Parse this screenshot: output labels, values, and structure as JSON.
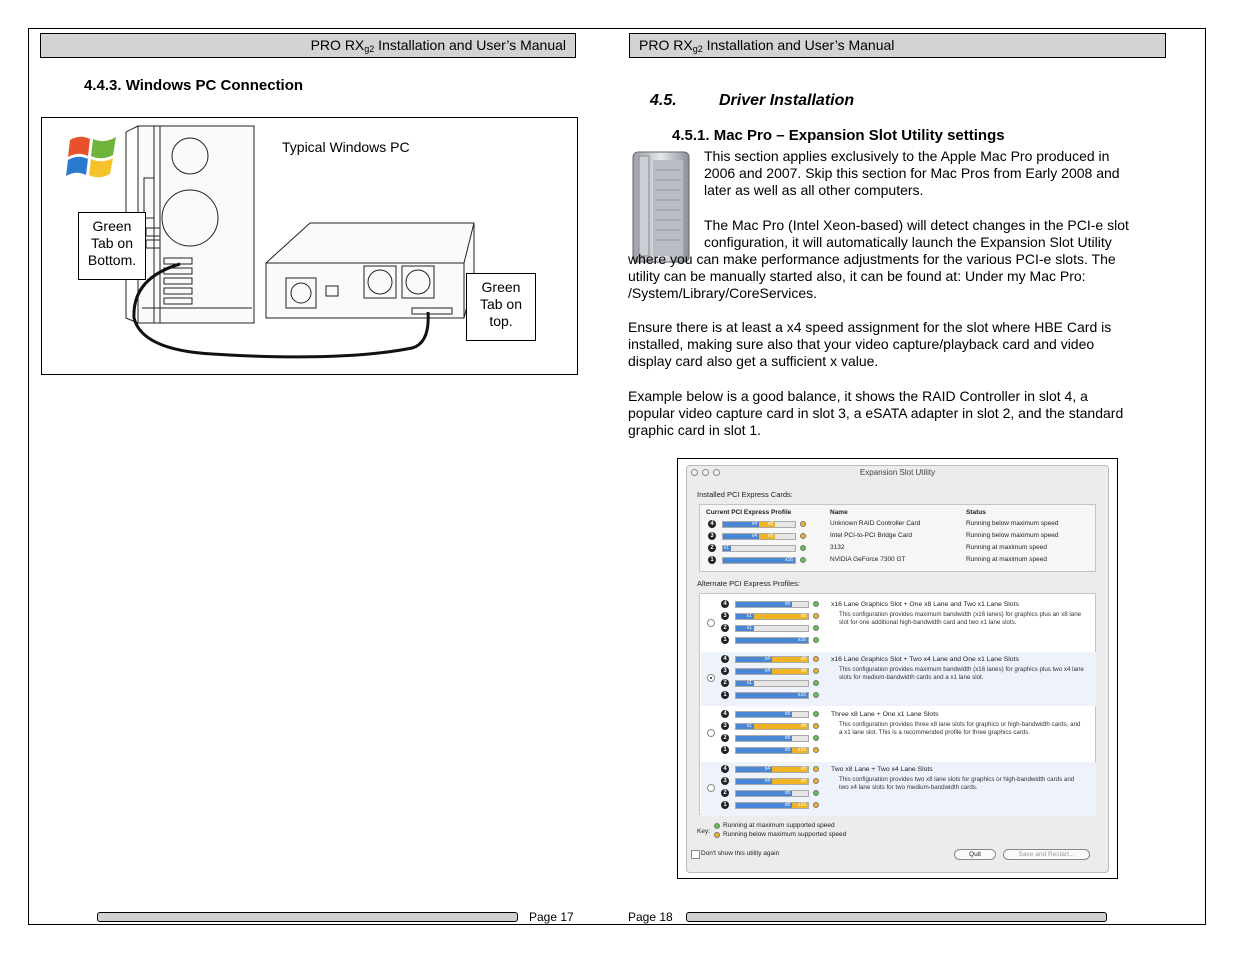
{
  "header": {
    "left_title_pre": "PRO RX",
    "left_title_sub": "g2",
    "left_title_post": " Installation and User’s Manual",
    "right_title_pre": "PRO RX",
    "right_title_sub": "g2",
    "right_title_post": " Installation and User’s Manual"
  },
  "left": {
    "heading": "4.4.3. Windows PC Connection",
    "figure": {
      "caption": "Typical Windows PC",
      "callout_bottom": [
        "Green",
        "Tab on",
        "Bottom."
      ],
      "callout_top": [
        "Green",
        "Tab on",
        "top."
      ]
    }
  },
  "right": {
    "section_num": "4.5.",
    "section_title": "Driver Installation",
    "subheading": "4.5.1. Mac Pro – Expansion Slot Utility settings",
    "p1_lines": [
      "This section applies exclusively to the Apple Mac Pro produced in",
      "2006 and 2007.   Skip this section for Mac Pros from Early 2008 and",
      "later as well as all other computers."
    ],
    "p2_lines": [
      "The Mac Pro (Intel Xeon-based) will detect changes in the PCI-e slot",
      "configuration, it will automatically launch the Expansion Slot Utility"
    ],
    "p2_cont_lines": [
      "where you can make performance adjustments for the various PCI-e slots.  The",
      "utility can be manually started also, it can be found at: Under my Mac Pro:",
      "/System/Library/CoreServices."
    ],
    "p3_lines": [
      "Ensure there is at least a x4 speed assignment for the slot where HBE Card is",
      "installed, making sure also that your video capture/playback card and video",
      "display card also get a sufficient x value."
    ],
    "p4_lines": [
      "Example below is a good balance, it shows the RAID Controller in slot 4, a",
      "popular video capture card in slot 3, a eSATA adapter in slot 2, and the standard",
      "graphic card in slot 1."
    ]
  },
  "utility": {
    "window_title": "Expansion Slot Utility",
    "installed_label": "Installed PCI Express Cards:",
    "col_profile": "Current PCI Express Profile",
    "col_name": "Name",
    "col_status": "Status",
    "installed": [
      {
        "slot": "4",
        "seg1": "x4",
        "seg2": "x8",
        "name": "Unknown RAID Controller Card",
        "status": "Running below maximum speed",
        "ok": false
      },
      {
        "slot": "3",
        "seg1": "x4",
        "seg2": "x8",
        "name": "Intel PCI-to-PCI Bridge Card",
        "status": "Running below maximum speed",
        "ok": false
      },
      {
        "slot": "2",
        "seg1": "x1",
        "seg2": "",
        "name": "3132",
        "status": "Running at maximum speed",
        "ok": true
      },
      {
        "slot": "1",
        "seg1": "x16",
        "seg2": "",
        "name": "NVIDIA GeForce 7300 GT",
        "status": "Running at maximum speed",
        "ok": true
      }
    ],
    "alternate_label": "Alternate PCI Express Profiles:",
    "profiles": [
      {
        "title": "x16 Lane Graphics Slot + One x8 Lane and Two x1 Lane Slots",
        "desc": "This configuration provides maximum bandwidth (x16 lanes) for graphics plus an x8 lane slot for one additional high-bandwidth card and two x1 lane slots.",
        "selected": false
      },
      {
        "title": "x16 Lane Graphics Slot + Two x4 Lane and One x1 Lane Slots",
        "desc": "This configuration provides maximum bandwidth (x16 lanes) for graphics plus two x4 lane slots for medium-bandwidth cards and a x1 lane slot.",
        "selected": true
      },
      {
        "title": "Three x8 Lane + One x1 Lane Slots",
        "desc": "This configuration provides three x8 lane slots for graphics or high-bandwidth cards, and a x1 lane slot.  This is a recommended profile for three graphics cards.",
        "selected": false
      },
      {
        "title": "Two x8 Lane + Two x4 Lane Slots",
        "desc": "This configuration provides two x8 lane slots for graphics or high-bandwidth cards and two x4 lane slots for two medium-bandwidth cards.",
        "selected": false
      }
    ],
    "key_label": "Key:",
    "key_ok": "Running at maximum supported speed",
    "key_below": "Running below maximum supported speed",
    "dont_show": "Don't show this utility again",
    "quit": "Quit",
    "save_restart": "Save and Restart..."
  },
  "footer": {
    "left_page": "Page 17",
    "right_page": "Page 18"
  }
}
